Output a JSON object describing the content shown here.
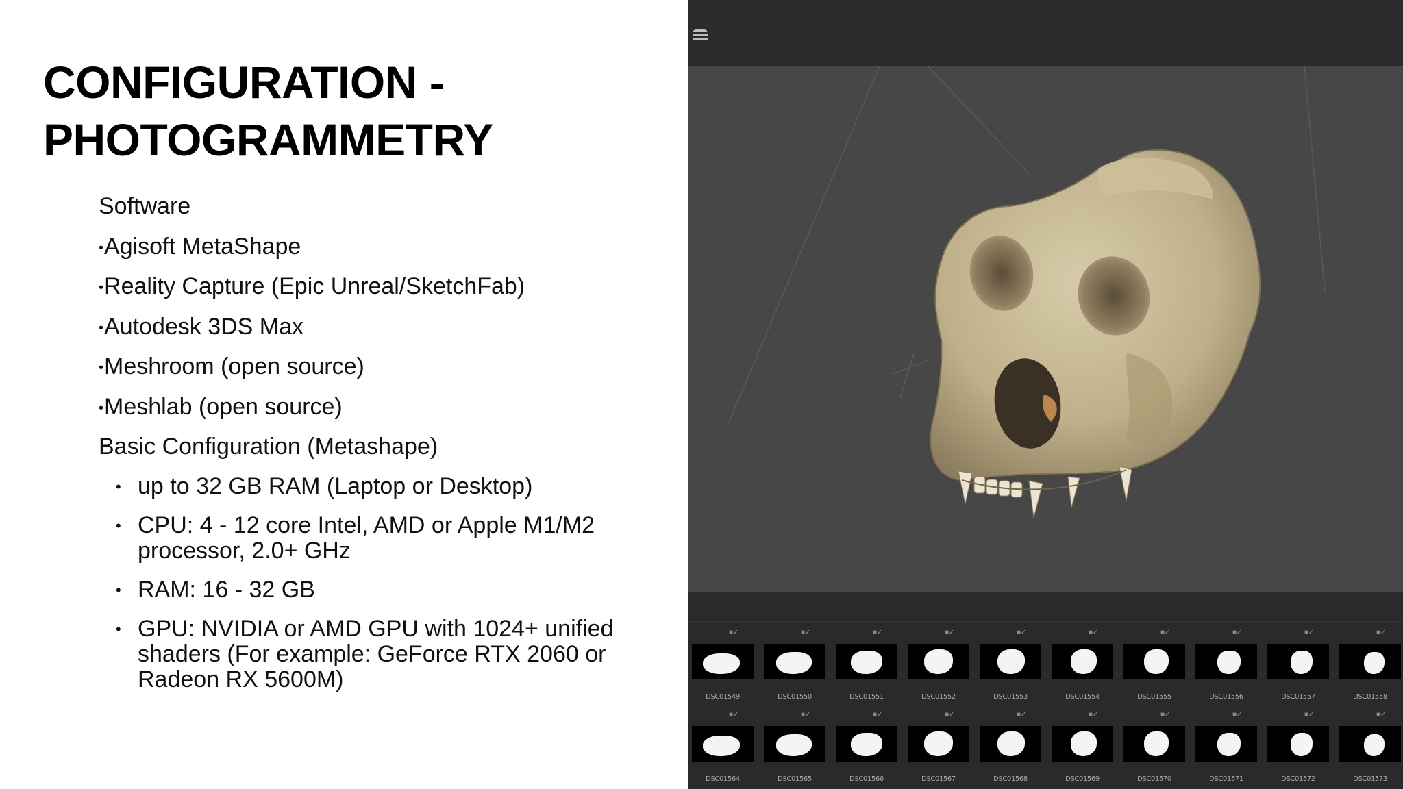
{
  "slide": {
    "title_line1": "CONFIGURATION -",
    "title_line2": "PHOTOGRAMMETRY"
  },
  "software": {
    "heading": "Software",
    "items": [
      "Agisoft MetaShape",
      "Reality Capture (Epic Unreal/SketchFab)",
      "Autodesk 3DS Max",
      "Meshroom (open source)",
      "Meshlab (open source)"
    ]
  },
  "basic_config": {
    "heading": "Basic Configuration (Metashape)",
    "items": [
      "up to 32 GB RAM (Laptop or Desktop)",
      "CPU: 4 - 12 core Intel, AMD or Apple M1/M2 processor, 2.0+ GHz",
      "RAM: 16 - 32 GB",
      "GPU: NVIDIA or AMD GPU with 1024+ unified shaders (For example: GeForce RTX 2060 or Radeon RX 5600M)"
    ]
  },
  "viewer": {
    "menu_icon": "hamburger-icon",
    "model": "gorilla-skull-3d-model",
    "colors": {
      "panel": "#2f2f2f",
      "viewport": "#474747",
      "bone": "#c9bc98"
    },
    "thumbnails_row1": [
      "DSC01549",
      "DSC01550",
      "DSC01551",
      "DSC01552",
      "DSC01553",
      "DSC01554",
      "DSC01555",
      "DSC01556",
      "DSC01557",
      "DSC01558"
    ],
    "thumbnails_row2": [
      "DSC01564",
      "DSC01565",
      "DSC01566",
      "DSC01567",
      "DSC01568",
      "DSC01569",
      "DSC01570",
      "DSC01571",
      "DSC01572",
      "DSC01573"
    ]
  }
}
